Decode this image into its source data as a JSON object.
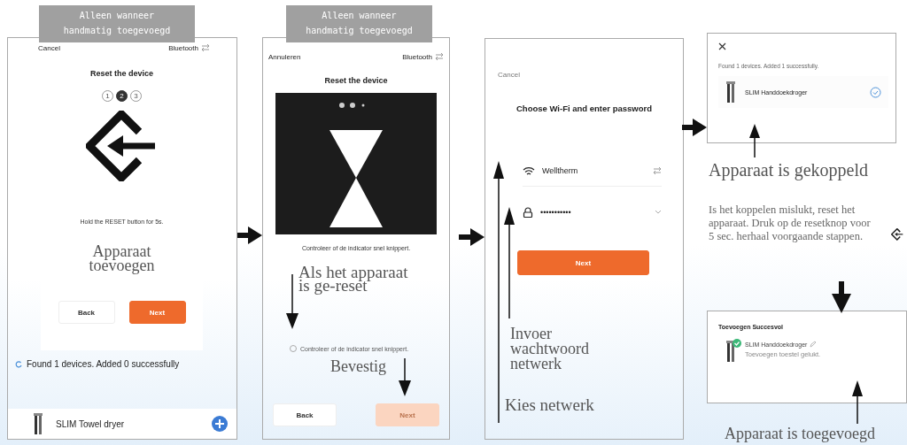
{
  "steps": [
    {
      "kind": "reset_symbol",
      "label": "Alleen wanneer handmatig toegevoegd",
      "cancel": "Cancel",
      "mode": "Bluetooth",
      "title": "Reset the device",
      "step_dots": [
        {
          "text": "1",
          "selected": false
        },
        {
          "text": "2",
          "selected": true
        },
        {
          "text": "3",
          "selected": false
        }
      ],
      "instruction": "Hold the RESET button for 5s.",
      "note": "Apparaat toevoegen",
      "buttons": [
        {
          "label": "Back",
          "primary": false
        },
        {
          "label": "Next",
          "primary": true,
          "disabled": false
        }
      ],
      "status": "Found 1 devices. Added 0 successfully",
      "device": {
        "name": "SLIM Towel dryer"
      }
    },
    {
      "kind": "reset_video",
      "label": "Alleen wanneer handmatig toegevoegd",
      "cancel": "Annuleren",
      "mode": "Bluetooth",
      "title": "Reset the device",
      "instruction": "Controleer of de indicator snel knippert.",
      "note": "Als het apparaat is ge-reset",
      "confirm": {
        "label": "Controleer of de indicator snel knippert.",
        "checked": false
      },
      "confirm_note": "Bevestig",
      "buttons": [
        {
          "label": "Back",
          "primary": false
        },
        {
          "label": "Next",
          "primary": true,
          "disabled": true
        }
      ]
    },
    {
      "kind": "wifi",
      "cancel": "Cancel",
      "title": "Choose Wi-Fi and enter password",
      "network": "Welltherm",
      "password": "•••••••••••",
      "button": "Next",
      "notes": [
        "Invoer wachtwoord netwerk",
        "Kies netwerk"
      ]
    },
    {
      "kind": "result",
      "status": "Found 1 devices. Added 1 successfully.",
      "device": {
        "name": "SLIM Handdoekdroger",
        "added": true
      },
      "note": "Apparaat is gekoppeld",
      "help": "Is het koppelen mislukt, reset het apparaat. Druk op de resetknop voor 5 sec. herhaal voorgaande stappen."
    },
    {
      "kind": "success",
      "title": "Toevoegen Succesvol",
      "device": {
        "name": "SLIM Handdoekdroger",
        "subtitle": "Toevoegen toestel gelukt.",
        "added": true
      },
      "note": "Apparaat is toegevoegd"
    }
  ]
}
